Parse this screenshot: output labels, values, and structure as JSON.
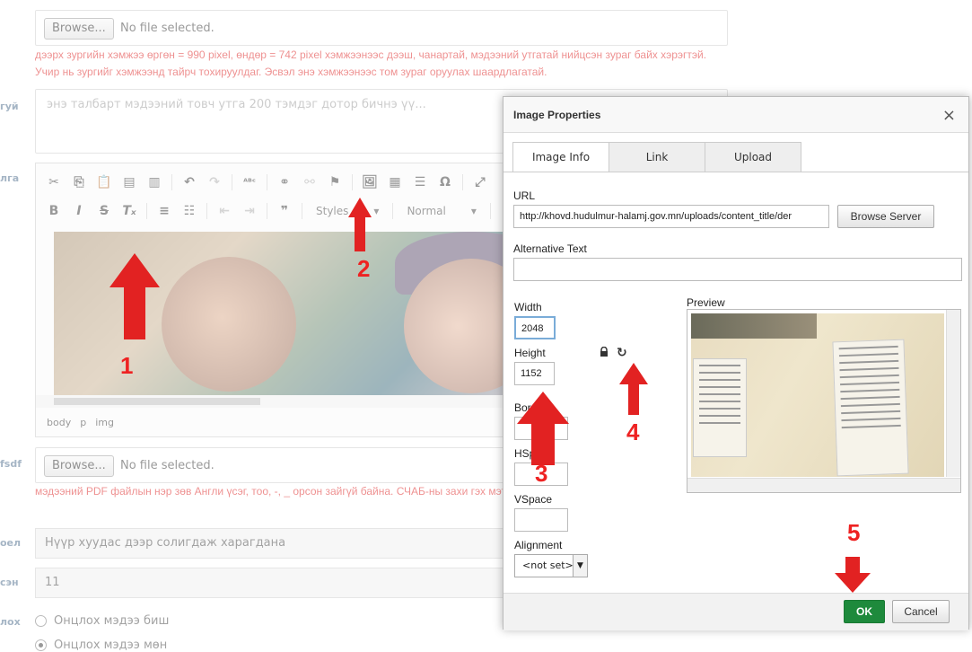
{
  "background": {
    "file1": {
      "browse_label": "Browse...",
      "no_file": "No file selected."
    },
    "note1": "дээрх зургийн хэмжээ өргөн = 990 pixel, өндөр = 742 pixel хэмжээнээс дээш, чанартай, мэдээний утгатай нийцсэн зураг байх хэрэгтэй. Учир нь зургийг хэмжээнд тайрч тохируулдаг. Эсвэл энэ хэмжээнээс том зураг оруулах шаардлагатай.",
    "labels": [
      "гуй",
      "лга",
      "fsdf",
      "оел",
      "сэн",
      "лох"
    ],
    "summary_placeholder": "энэ талбарт мэдээний товч утга 200 тэмдэг дотор бичнэ үү...",
    "editor": {
      "combo_styles": "Styles",
      "combo_format": "Normal",
      "path": [
        "body",
        "p",
        "img"
      ]
    },
    "file2": {
      "browse_label": "Browse...",
      "no_file": "No file selected."
    },
    "note2": "мэдээний PDF файлын нэр зөв Англи үсэг, тоо, -, _ орсон зайгүй байна. СЧАБ-ны захи гэх мэт бичнэ.",
    "select_value": "Нүүр хуудас дээр солигдаж харагдана",
    "number_value": "11",
    "radio1": "Онцлох мэдээ биш",
    "radio2": "Онцлох мэдээ мөн"
  },
  "dialog": {
    "title": "Image Properties",
    "close": "×",
    "tabs": [
      {
        "label": "Image Info"
      },
      {
        "label": "Link"
      },
      {
        "label": "Upload"
      }
    ],
    "url_label": "URL",
    "url_value": "http://khovd.hudulmur-halamj.gov.mn/uploads/content_title/der",
    "browse_server": "Browse Server",
    "alt_label": "Alternative Text",
    "alt_value": "",
    "width_label": "Width",
    "width_value": "2048",
    "height_label": "Height",
    "height_value": "1152",
    "border_label": "Border",
    "hspace_label": "HSpace",
    "vspace_label": "VSpace",
    "alignment_label": "Alignment",
    "alignment_value": "<not set>",
    "preview_label": "Preview",
    "ok": "OK",
    "cancel": "Cancel"
  },
  "annotations": [
    "1",
    "2",
    "3",
    "4",
    "5"
  ],
  "colors": {
    "annotation": "#e22222",
    "ok_button": "#1e8a3c",
    "note_text": "#dd2222"
  }
}
